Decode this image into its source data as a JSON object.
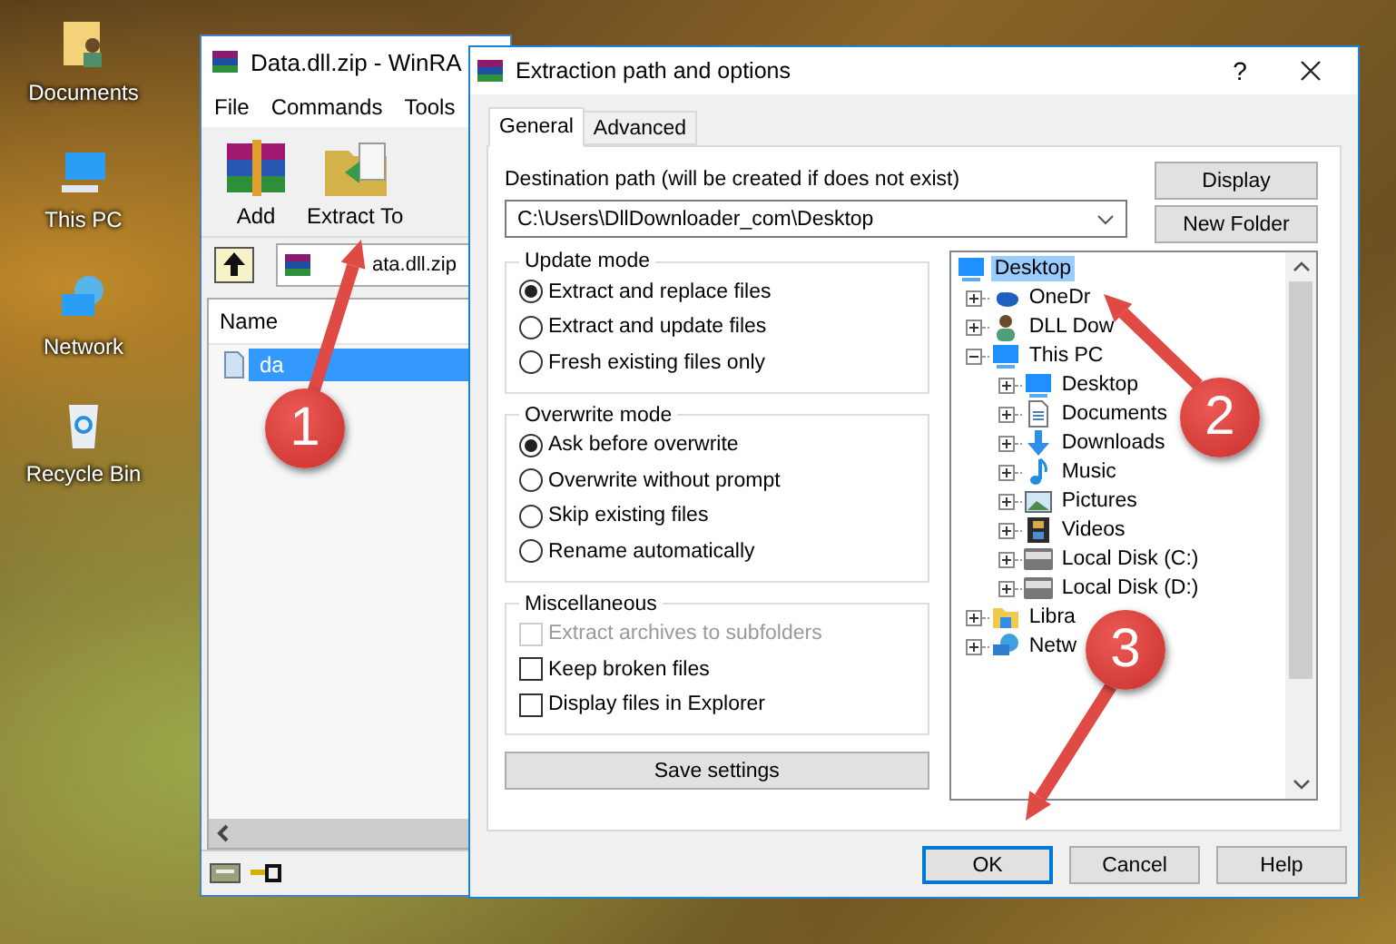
{
  "desktop": {
    "icons": [
      {
        "label": "Documents"
      },
      {
        "label": "This PC"
      },
      {
        "label": "Network"
      },
      {
        "label": "Recycle Bin"
      }
    ]
  },
  "winrar": {
    "title": "Data.dll.zip - WinRA",
    "menu": [
      "File",
      "Commands",
      "Tools"
    ],
    "toolbar": [
      "Add",
      "Extract To"
    ],
    "address": "ata.dll.zip",
    "columns": [
      "Name"
    ],
    "files": [
      {
        "name": "da",
        "selected": true
      }
    ]
  },
  "dialog": {
    "title": "Extraction path and options",
    "help": "?",
    "tabs": [
      {
        "label": "General",
        "selected": true
      },
      {
        "label": "Advanced",
        "selected": false
      }
    ],
    "destination": {
      "label": "Destination path (will be created if does not exist)",
      "value": "C:\\Users\\DllDownloader_com\\Desktop"
    },
    "side_buttons": [
      "Display",
      "New Folder"
    ],
    "groups": [
      {
        "title": "Update mode",
        "options": [
          {
            "kind": "radio",
            "label": "Extract and replace files",
            "checked": true,
            "disabled": false
          },
          {
            "kind": "radio",
            "label": "Extract and update files",
            "checked": false,
            "disabled": false
          },
          {
            "kind": "radio",
            "label": "Fresh existing files only",
            "checked": false,
            "disabled": false
          }
        ]
      },
      {
        "title": "Overwrite mode",
        "options": [
          {
            "kind": "radio",
            "label": "Ask before overwrite",
            "checked": true,
            "disabled": false
          },
          {
            "kind": "radio",
            "label": "Overwrite without prompt",
            "checked": false,
            "disabled": false
          },
          {
            "kind": "radio",
            "label": "Skip existing files",
            "checked": false,
            "disabled": false
          },
          {
            "kind": "radio",
            "label": "Rename automatically",
            "checked": false,
            "disabled": false
          }
        ]
      },
      {
        "title": "Miscellaneous",
        "options": [
          {
            "kind": "checkbox",
            "label": "Extract archives to subfolders",
            "checked": false,
            "disabled": true
          },
          {
            "kind": "checkbox",
            "label": "Keep broken files",
            "checked": false,
            "disabled": false
          },
          {
            "kind": "checkbox",
            "label": "Display files in Explorer",
            "checked": false,
            "disabled": false
          }
        ]
      }
    ],
    "save_button": "Save settings",
    "tree": [
      {
        "label": "Desktop",
        "selected": true,
        "children": [
          {
            "label": "OneDr",
            "selected": false,
            "expanded": false
          },
          {
            "label": "DLL Dow",
            "selected": false,
            "expanded": false
          },
          {
            "label": "This PC",
            "selected": false,
            "expanded": true,
            "children": [
              {
                "label": "Desktop",
                "selected": false,
                "expanded": false
              },
              {
                "label": "Documents",
                "selected": false,
                "expanded": false
              },
              {
                "label": "Downloads",
                "selected": false,
                "expanded": false
              },
              {
                "label": "Music",
                "selected": false,
                "expanded": false
              },
              {
                "label": "Pictures",
                "selected": false,
                "expanded": false
              },
              {
                "label": "Videos",
                "selected": false,
                "expanded": false
              },
              {
                "label": "Local Disk (C:)",
                "selected": false,
                "expanded": false
              },
              {
                "label": "Local Disk (D:)",
                "selected": false,
                "expanded": false
              }
            ]
          },
          {
            "label": "Libra",
            "selected": false,
            "expanded": false
          },
          {
            "label": "Netw",
            "selected": false,
            "expanded": false
          }
        ]
      }
    ],
    "buttons": [
      {
        "label": "OK",
        "default": true
      },
      {
        "label": "Cancel",
        "default": false
      },
      {
        "label": "Help",
        "default": false
      }
    ]
  },
  "annotations": [
    {
      "label": "1"
    },
    {
      "label": "2"
    },
    {
      "label": "3"
    }
  ]
}
